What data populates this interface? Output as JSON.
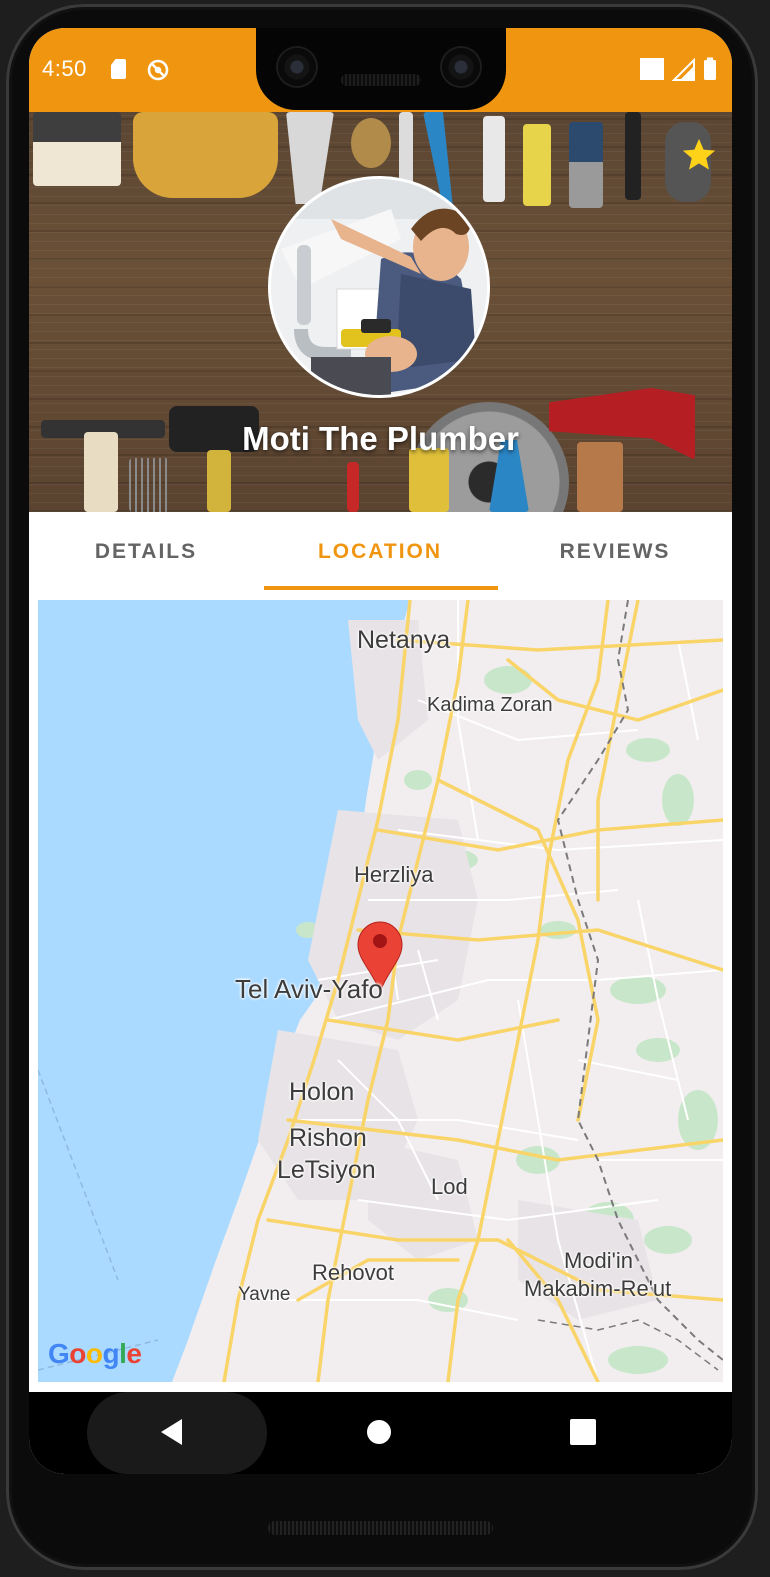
{
  "status_bar": {
    "time": "4:50",
    "icons": [
      "sd-card-icon",
      "sync-disabled-icon",
      "wifi-icon",
      "cell-signal-icon",
      "battery-icon"
    ],
    "background": "#f0950f"
  },
  "profile": {
    "name": "Moti The Plumber",
    "favorite_icon": "star-icon",
    "favorite_color": "#ffd21a"
  },
  "tabs": [
    {
      "label": "DETAILS",
      "active": false
    },
    {
      "label": "LOCATION",
      "active": true
    },
    {
      "label": "REVIEWS",
      "active": false
    }
  ],
  "map": {
    "labels": {
      "netanya": "Netanya",
      "kadima": "Kadima Zoran",
      "herzliya": "Herzliya",
      "tel_aviv": "Tel Aviv-Yafo",
      "holon": "Holon",
      "rishon_1": "Rishon",
      "rishon_2": "LeTsiyon",
      "lod": "Lod",
      "modiin_1": "Modi'in",
      "modiin_2": "Makabim-Re'ut",
      "rehovot": "Rehovot",
      "yavne": "Yavne"
    },
    "attribution": "Google",
    "marker_icon": "map-pin-icon",
    "sea_color": "#aadaff",
    "land_color": "#f2eef0",
    "road_color": "#f9d468",
    "park_color": "#c8e6c9"
  },
  "nav": {
    "back": "back-icon",
    "home": "home-icon",
    "recents": "recents-icon"
  },
  "accent_color": "#f0950f"
}
